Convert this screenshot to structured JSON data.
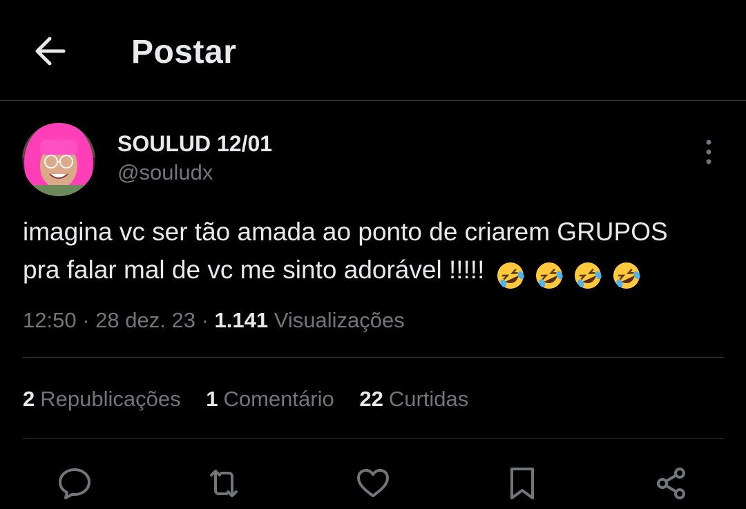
{
  "header": {
    "title": "Postar",
    "back_icon": "arrow-left-icon"
  },
  "post": {
    "author_name": "SOULUD 12/01",
    "handle": "@souludx",
    "text_line1": "imagina vc ser tão amada ao ponto de criarem GRUPOS",
    "text_line2": "pra falar mal de vc me sinto adorável !!!!!",
    "emoji_name": "rolling-on-the-floor-laughing-emoji",
    "time": "12:50",
    "date": "28 dez. 23",
    "views_count": "1.141",
    "views_label": "Visualizações",
    "separator": "·"
  },
  "stats": {
    "reposts_count": "2",
    "reposts_label": "Republicações",
    "comments_count": "1",
    "comments_label": "Comentário",
    "likes_count": "22",
    "likes_label": "Curtidas"
  },
  "actions": [
    "reply-icon",
    "repost-icon",
    "like-icon",
    "bookmark-icon",
    "share-icon"
  ],
  "colors": {
    "background": "#000000",
    "primary_text": "#e7e9ea",
    "secondary_text": "#71767b",
    "divider": "#2f3336",
    "avatar_hair": "#ff3fb8"
  }
}
